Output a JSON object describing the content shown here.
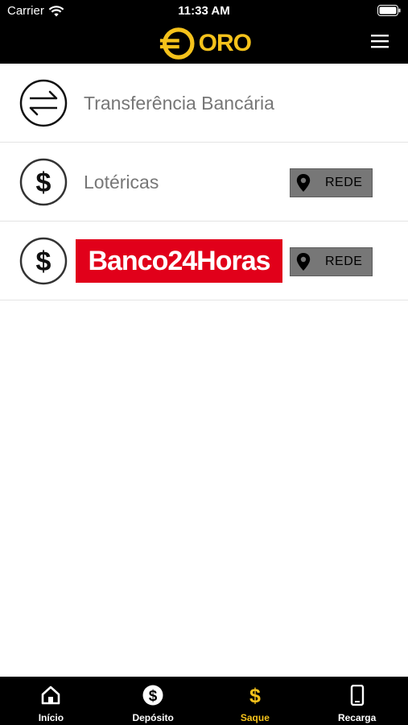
{
  "status_bar": {
    "carrier": "Carrier",
    "time": "11:33 AM"
  },
  "header": {
    "logo_text": "ORO",
    "menu_icon": "hamburger-menu-icon",
    "brand_color": "#f5c21b"
  },
  "list": [
    {
      "icon": "transfer-arrows-icon",
      "label": "Transferência Bancária"
    },
    {
      "icon": "dollar-circle-icon",
      "label": "Lotéricas",
      "action": "REDE"
    },
    {
      "icon": "dollar-circle-icon",
      "logo_text": "Banco24Horas",
      "action": "REDE"
    }
  ],
  "rede_icon": "location-pin-icon",
  "tabs": [
    {
      "label": "Início",
      "icon": "home-icon",
      "active": false
    },
    {
      "label": "Depósito",
      "icon": "dollar-badge-icon",
      "active": false
    },
    {
      "label": "Saque",
      "icon": "dollar-sign-icon",
      "active": true
    },
    {
      "label": "Recarga",
      "icon": "mobile-phone-icon",
      "active": false
    }
  ],
  "colors": {
    "bar_background": "#000000",
    "accent": "#f5c21b",
    "banco24_red": "#e1001a",
    "rede_button": "#777777",
    "label_gray": "#777777"
  }
}
